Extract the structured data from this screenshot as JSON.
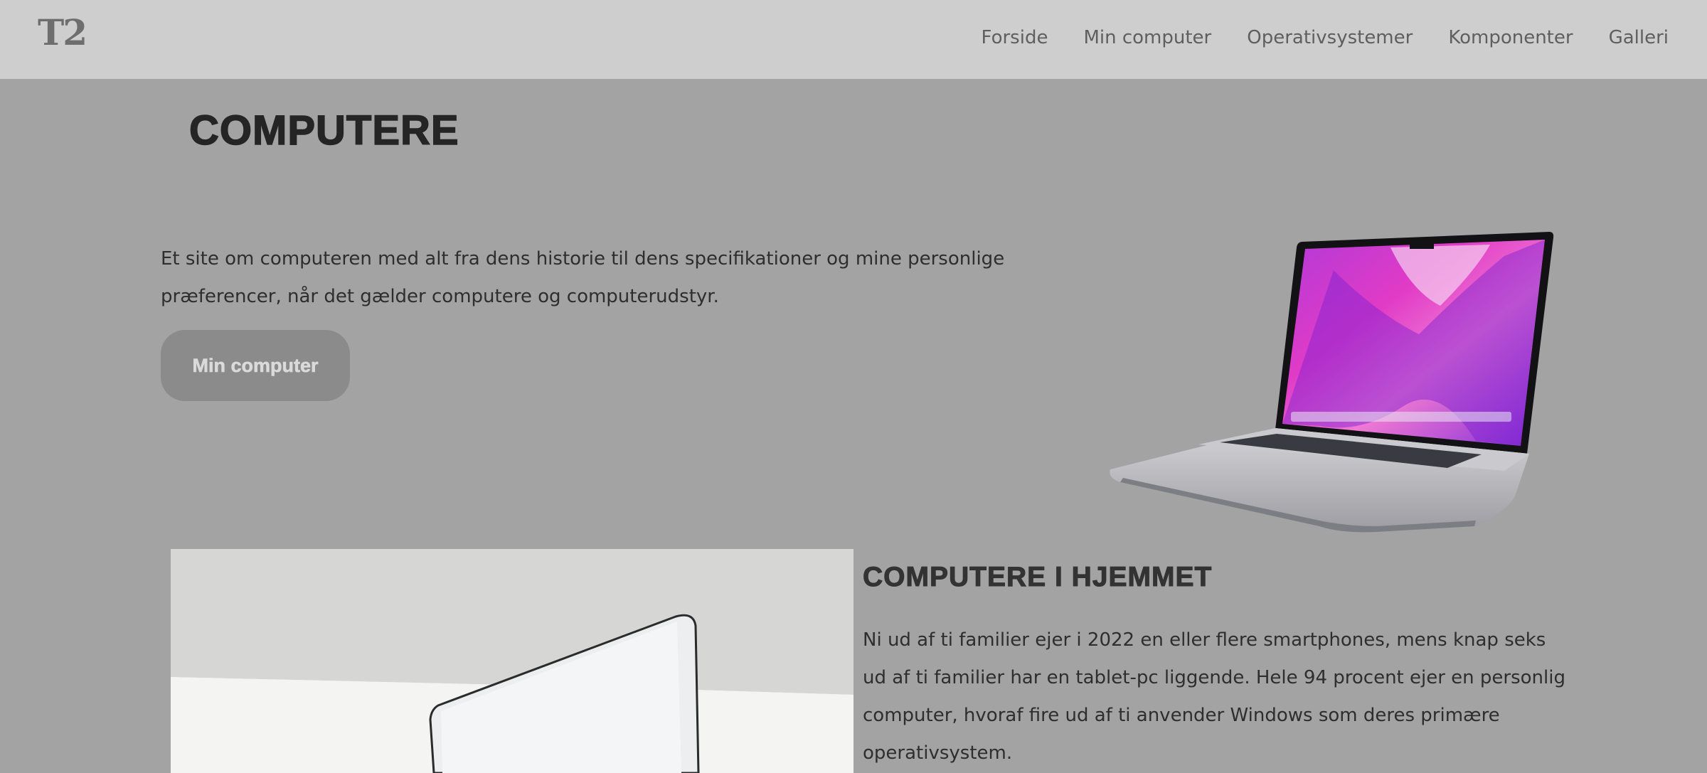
{
  "header": {
    "logo": "T2",
    "nav": [
      "Forside",
      "Min computer",
      "Operativsystemer",
      "Komponenter",
      "Galleri"
    ]
  },
  "hero": {
    "title": "COMPUTERE",
    "text": "Et site om computeren med alt fra dens historie til dens specifikationer og mine personlige præferencer, når det gælder computere og computerudstyr.",
    "button": "Min computer"
  },
  "section": {
    "title": "COMPUTERE I HJEMMET",
    "text": "Ni ud af ti familier ejer i 2022 en eller flere smartphones, mens knap seks ud af ti familier har en tablet-pc liggende. Hele 94 procent ejer en personlig computer, hvoraf fire ud af ti anvender Windows som deres primære operativsystem."
  },
  "colors": {
    "background": "#a3a3a3",
    "header": "#cecece",
    "button": "#8b8b8b",
    "screen_accent": "#d93ac9"
  },
  "icons": [
    "laptop-image",
    "laptop-photo"
  ]
}
